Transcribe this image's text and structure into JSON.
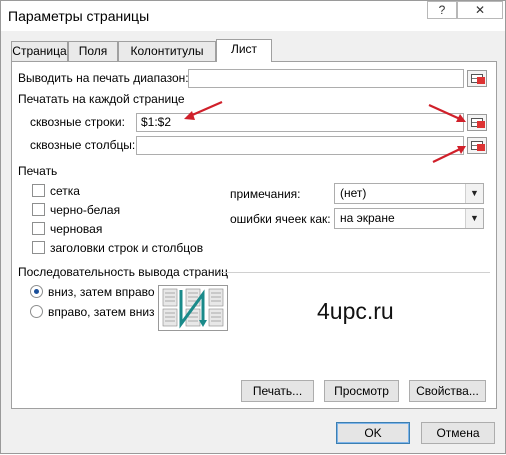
{
  "window": {
    "title": "Параметры страницы",
    "help_button": "?",
    "close_button": "✕"
  },
  "tabs": [
    {
      "label": "Страница"
    },
    {
      "label": "Поля"
    },
    {
      "label": "Колонтитулы"
    },
    {
      "label": "Лист",
      "active": true
    }
  ],
  "print_area": {
    "label": "Выводить на печать диапазон:",
    "value": ""
  },
  "print_titles": {
    "section_label": "Печатать на каждой странице",
    "rows_label": "сквозные строки:",
    "rows_value": "$1:$2",
    "cols_label": "сквозные столбцы:",
    "cols_value": ""
  },
  "print": {
    "section_label": "Печать",
    "checkboxes": [
      {
        "label": "сетка",
        "checked": false
      },
      {
        "label": "черно-белая",
        "checked": false
      },
      {
        "label": "черновая",
        "checked": false
      },
      {
        "label": "заголовки строк и столбцов",
        "checked": false
      }
    ],
    "comments_label": "примечания:",
    "comments_value": "(нет)",
    "errors_label": "ошибки ячеек как:",
    "errors_value": "на экране"
  },
  "page_order": {
    "section_label": "Последовательность вывода страниц",
    "options": [
      {
        "label": "вниз, затем вправо",
        "selected": true
      },
      {
        "label": "вправо, затем вниз",
        "selected": false
      }
    ]
  },
  "watermark": "4upc.ru",
  "buttons": {
    "print": "Печать...",
    "preview": "Просмотр",
    "properties": "Свойства...",
    "ok": "OK",
    "cancel": "Отмена"
  },
  "colors": {
    "arrow": "#d0202a",
    "accent": "#3c7fb1",
    "diagram_arrow": "#1a8a8a"
  },
  "icons": [
    "range-picker-icon",
    "dropdown-arrow-icon",
    "page-order-diagram-icon"
  ]
}
